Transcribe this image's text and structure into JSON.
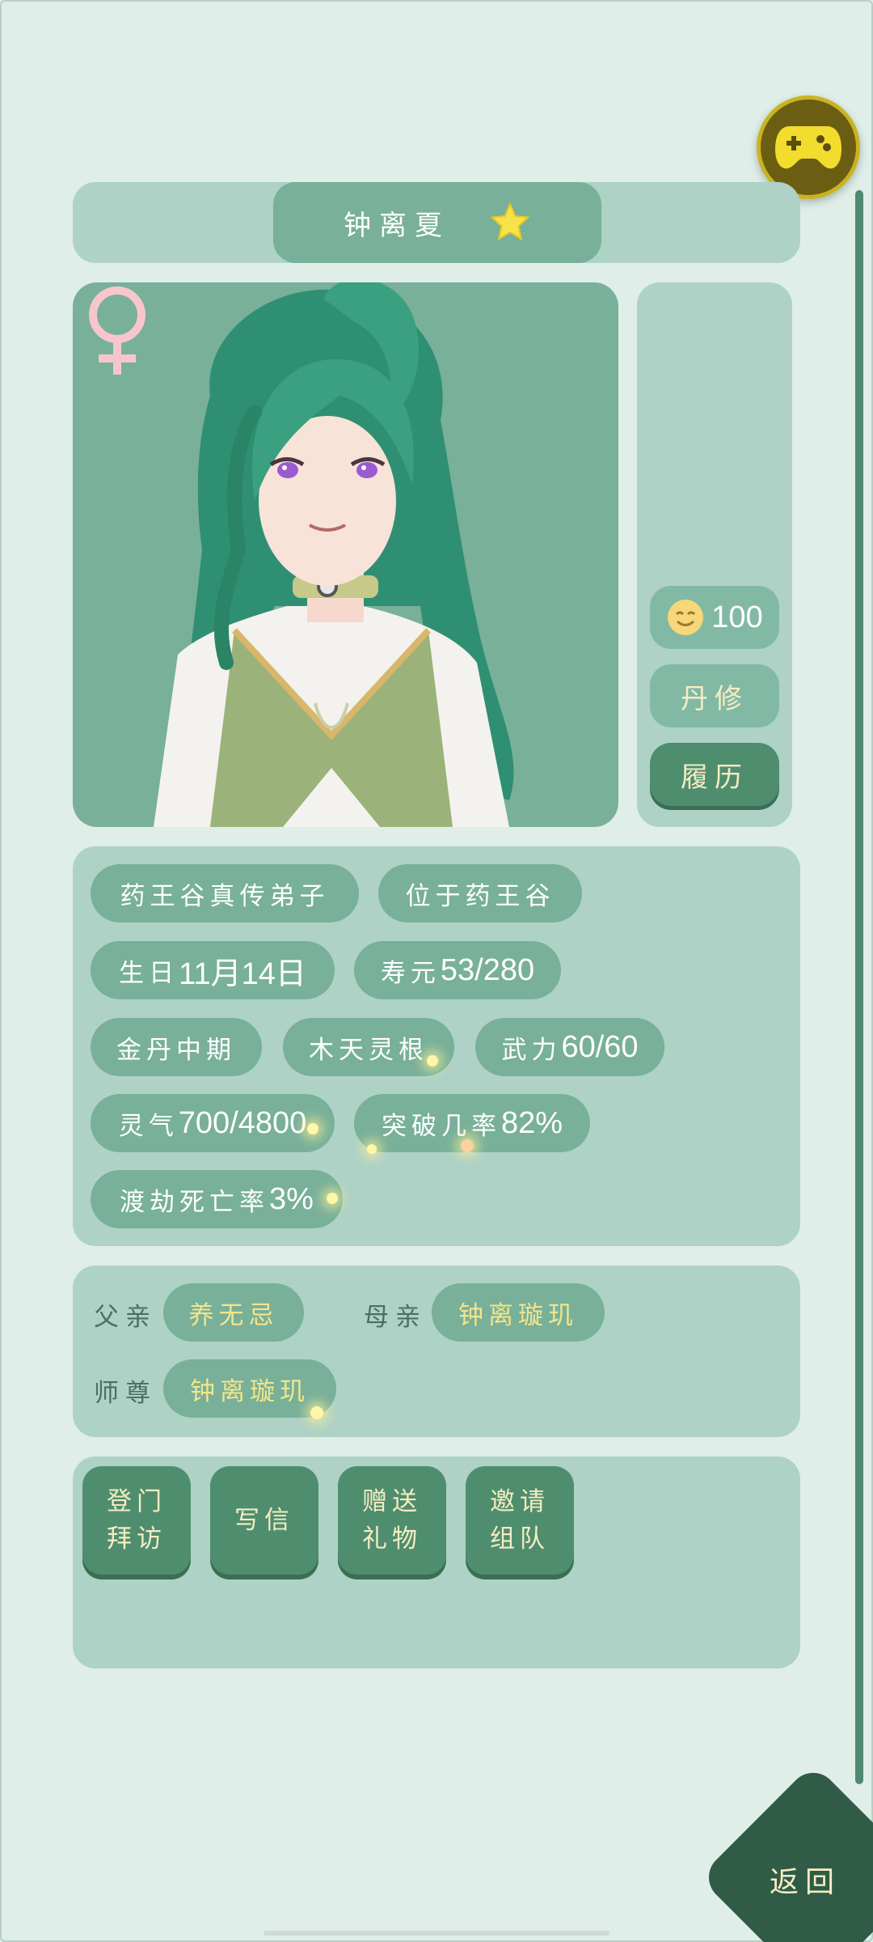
{
  "header": {
    "character_name": "钟离夏",
    "favorite_icon": "star-icon"
  },
  "portrait": {
    "gender_icon": "female-symbol-icon",
    "colors": {
      "background": "#78b09a",
      "hair": "#3a9e7e",
      "eyes": "#9a5bd1"
    }
  },
  "side_panel": {
    "mood_icon": "smiling-face-icon",
    "mood_value": "100",
    "profession": "丹修",
    "history_button": "履历"
  },
  "info_tags": [
    {
      "label": "药王谷真传弟子"
    },
    {
      "label": "位于药王谷"
    },
    {
      "prefix": "生日",
      "value": "11月14日"
    },
    {
      "prefix": "寿元",
      "value": "53/280"
    },
    {
      "label": "金丹中期"
    },
    {
      "label": "木天灵根"
    },
    {
      "prefix": "武力",
      "value": "60/60"
    },
    {
      "prefix": "灵气",
      "value": "700/4800"
    },
    {
      "prefix": "突破几率",
      "value": "82%"
    },
    {
      "prefix": "渡劫死亡率",
      "value": "3%"
    }
  ],
  "relations": {
    "father_label": "父亲",
    "father_name": "养无忌",
    "mother_label": "母亲",
    "mother_name": "钟离璇玑",
    "master_label": "师尊",
    "master_name": "钟离璇玑"
  },
  "actions": [
    {
      "line1": "登门",
      "line2": "拜访"
    },
    {
      "line1": "写信",
      "line2": ""
    },
    {
      "line1": "赠送",
      "line2": "礼物"
    },
    {
      "line1": "邀请",
      "line2": "组队"
    }
  ],
  "back_button": "返回",
  "floating_button_icon": "gamepad-icon",
  "theme_colors": {
    "page_bg": "#dfeee8",
    "panel_bg": "#aed2c6",
    "pill_bg": "#78b09a",
    "button_bg": "#4e8e6e",
    "gold_text": "#f3e58a"
  }
}
